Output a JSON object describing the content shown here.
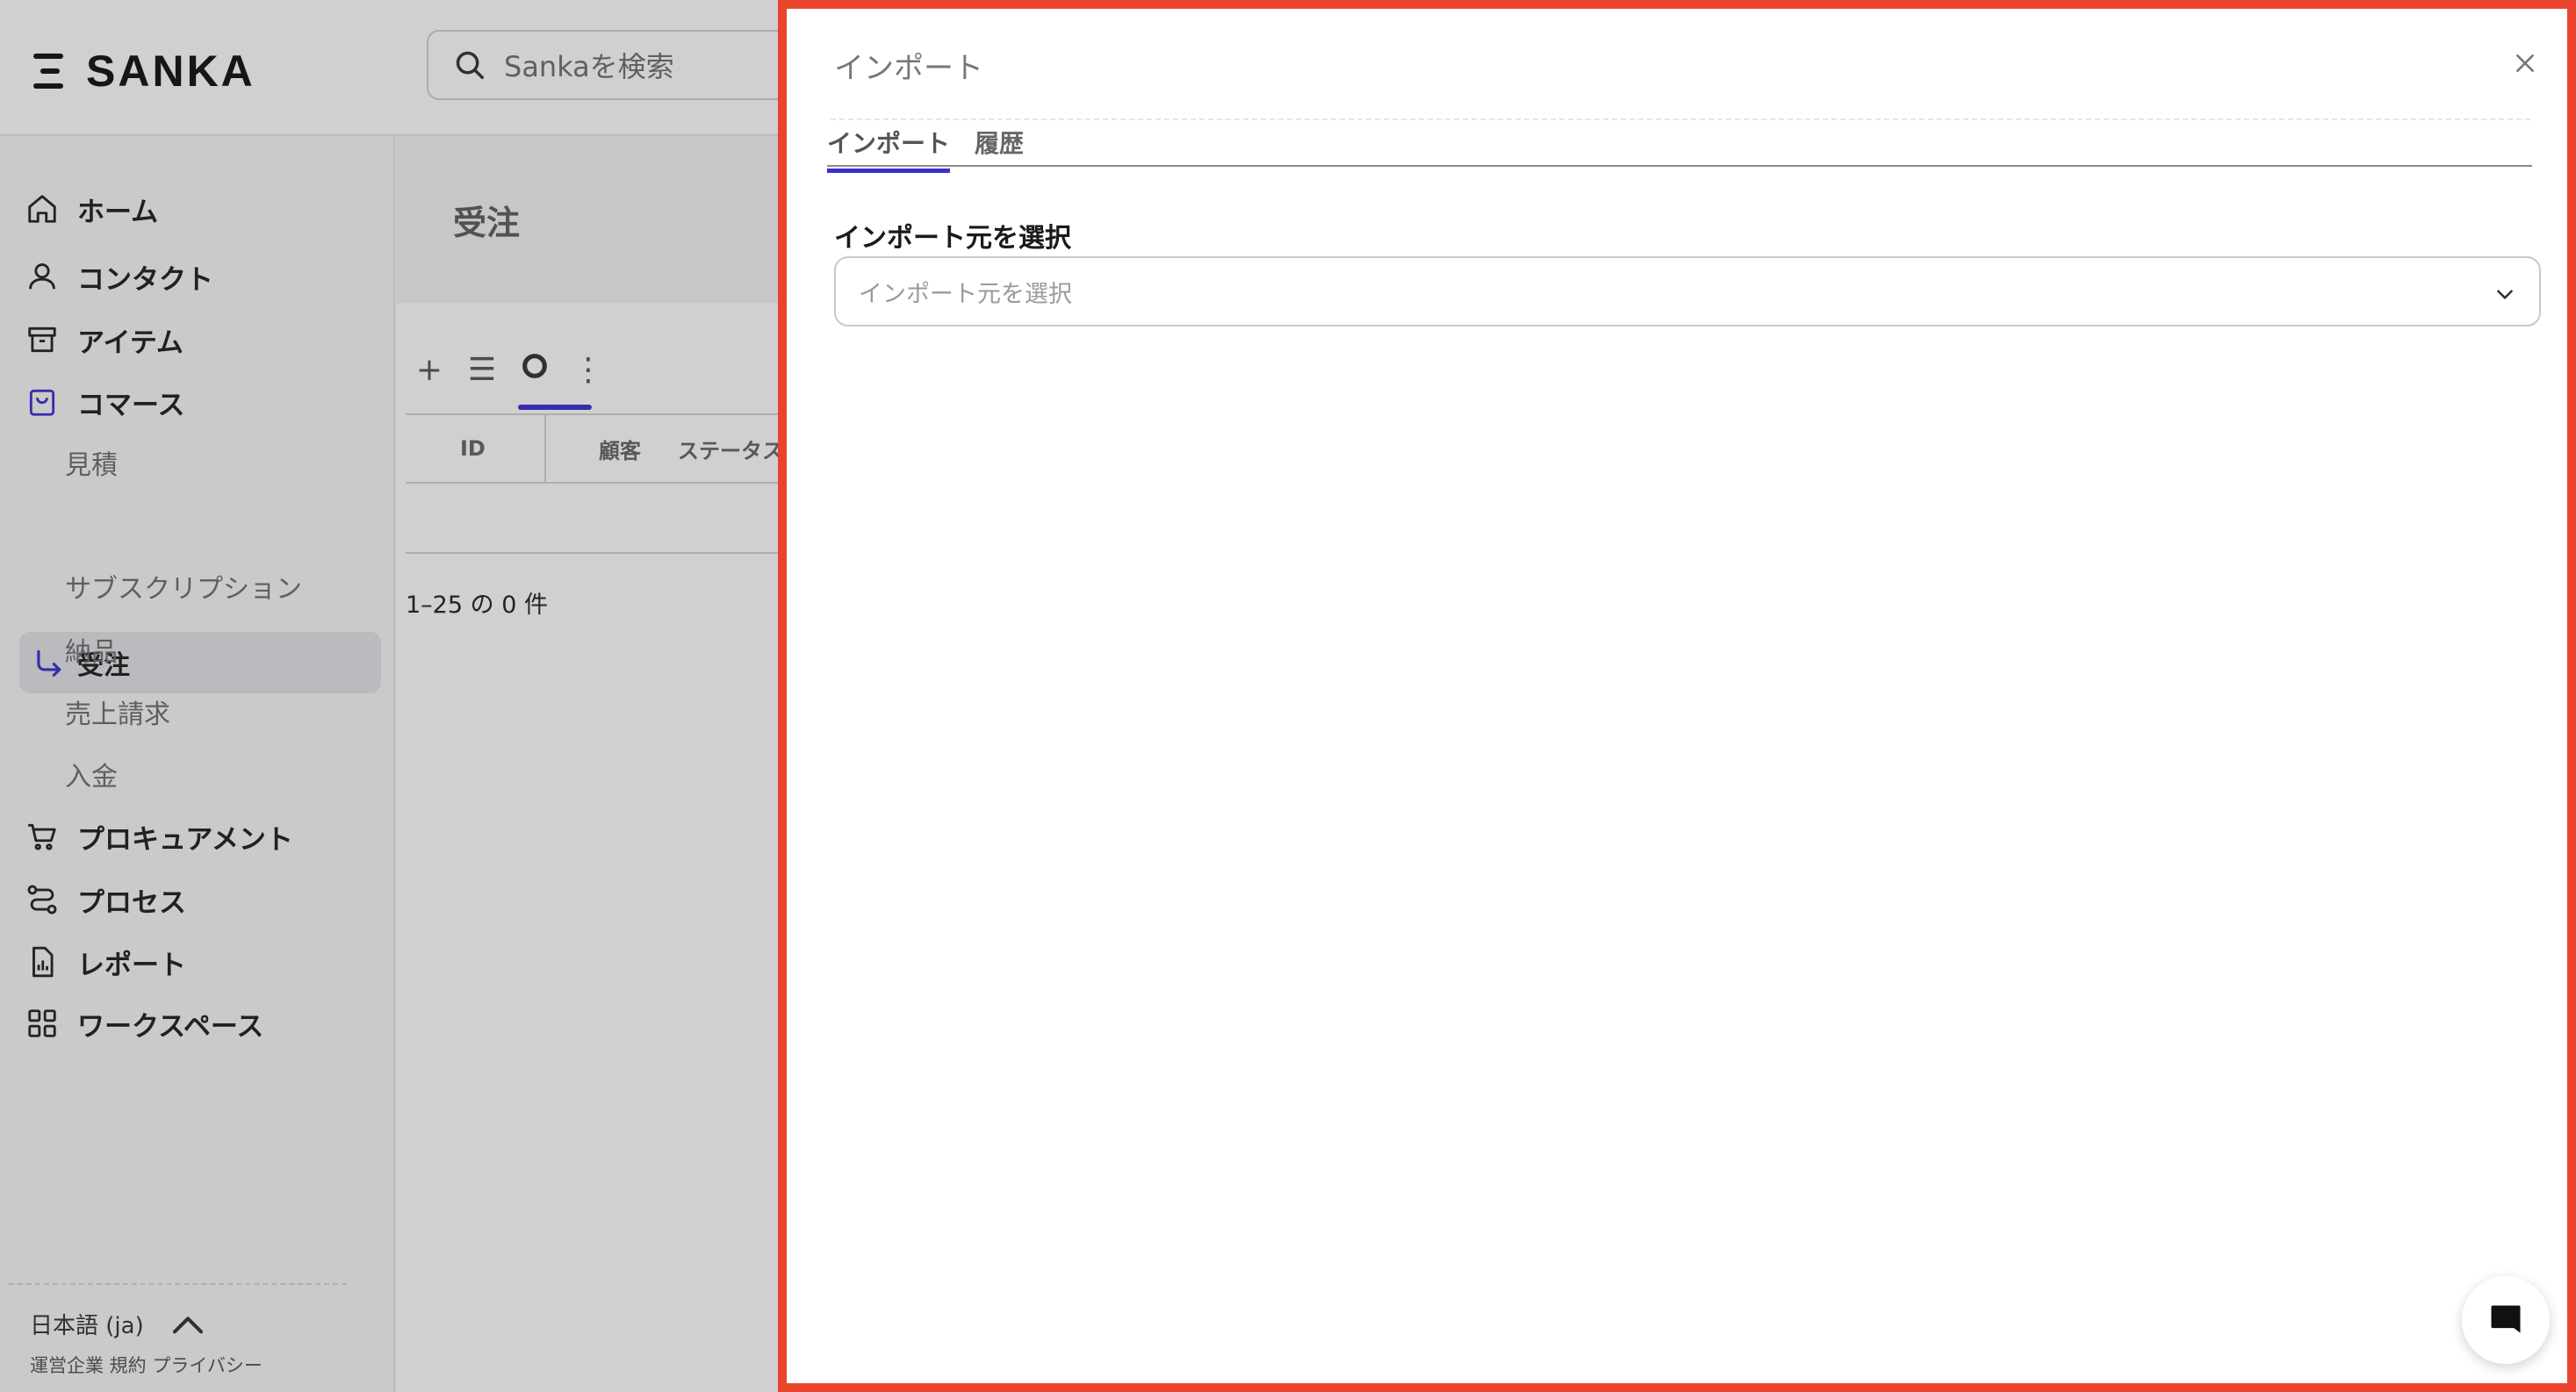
{
  "app": {
    "logo": "SANKA",
    "search_placeholder": "Sankaを検索"
  },
  "sidebar": {
    "items": [
      {
        "label": "ホーム",
        "icon": "home-icon"
      },
      {
        "label": "コンタクト",
        "icon": "user-icon"
      },
      {
        "label": "アイテム",
        "icon": "archive-icon"
      },
      {
        "label": "コマース",
        "icon": "shopping-bag-icon"
      }
    ],
    "commerce_sub": {
      "quote": "見積",
      "orders": "受注",
      "subscriptions": "サブスクリプション",
      "delivery": "納品",
      "invoice": "売上請求",
      "payment": "入金"
    },
    "items_bottom": [
      {
        "label": "プロキュアメント",
        "icon": "cart-icon"
      },
      {
        "label": "プロセス",
        "icon": "route-icon"
      },
      {
        "label": "レポート",
        "icon": "report-icon"
      },
      {
        "label": "ワークスペース",
        "icon": "grid-icon"
      }
    ],
    "language": "日本語 (ja)",
    "footer_links": "運営企業 規約 プライバシー"
  },
  "main": {
    "page_title": "受注",
    "toolbar": {
      "add": "+",
      "list": "☰",
      "menu": "⋮"
    },
    "table_headers": [
      "ID",
      "顧客",
      "ステータス"
    ],
    "pagination": "1–25 の 0 件"
  },
  "drawer": {
    "title": "インポート",
    "tabs": [
      "インポート",
      "履歴"
    ],
    "active_tab": "インポート",
    "field_label": "インポート元を選択",
    "select_placeholder": "インポート元を選択"
  },
  "colors": {
    "accent": "#3b2fd1",
    "drawer_border": "#e8432b"
  }
}
